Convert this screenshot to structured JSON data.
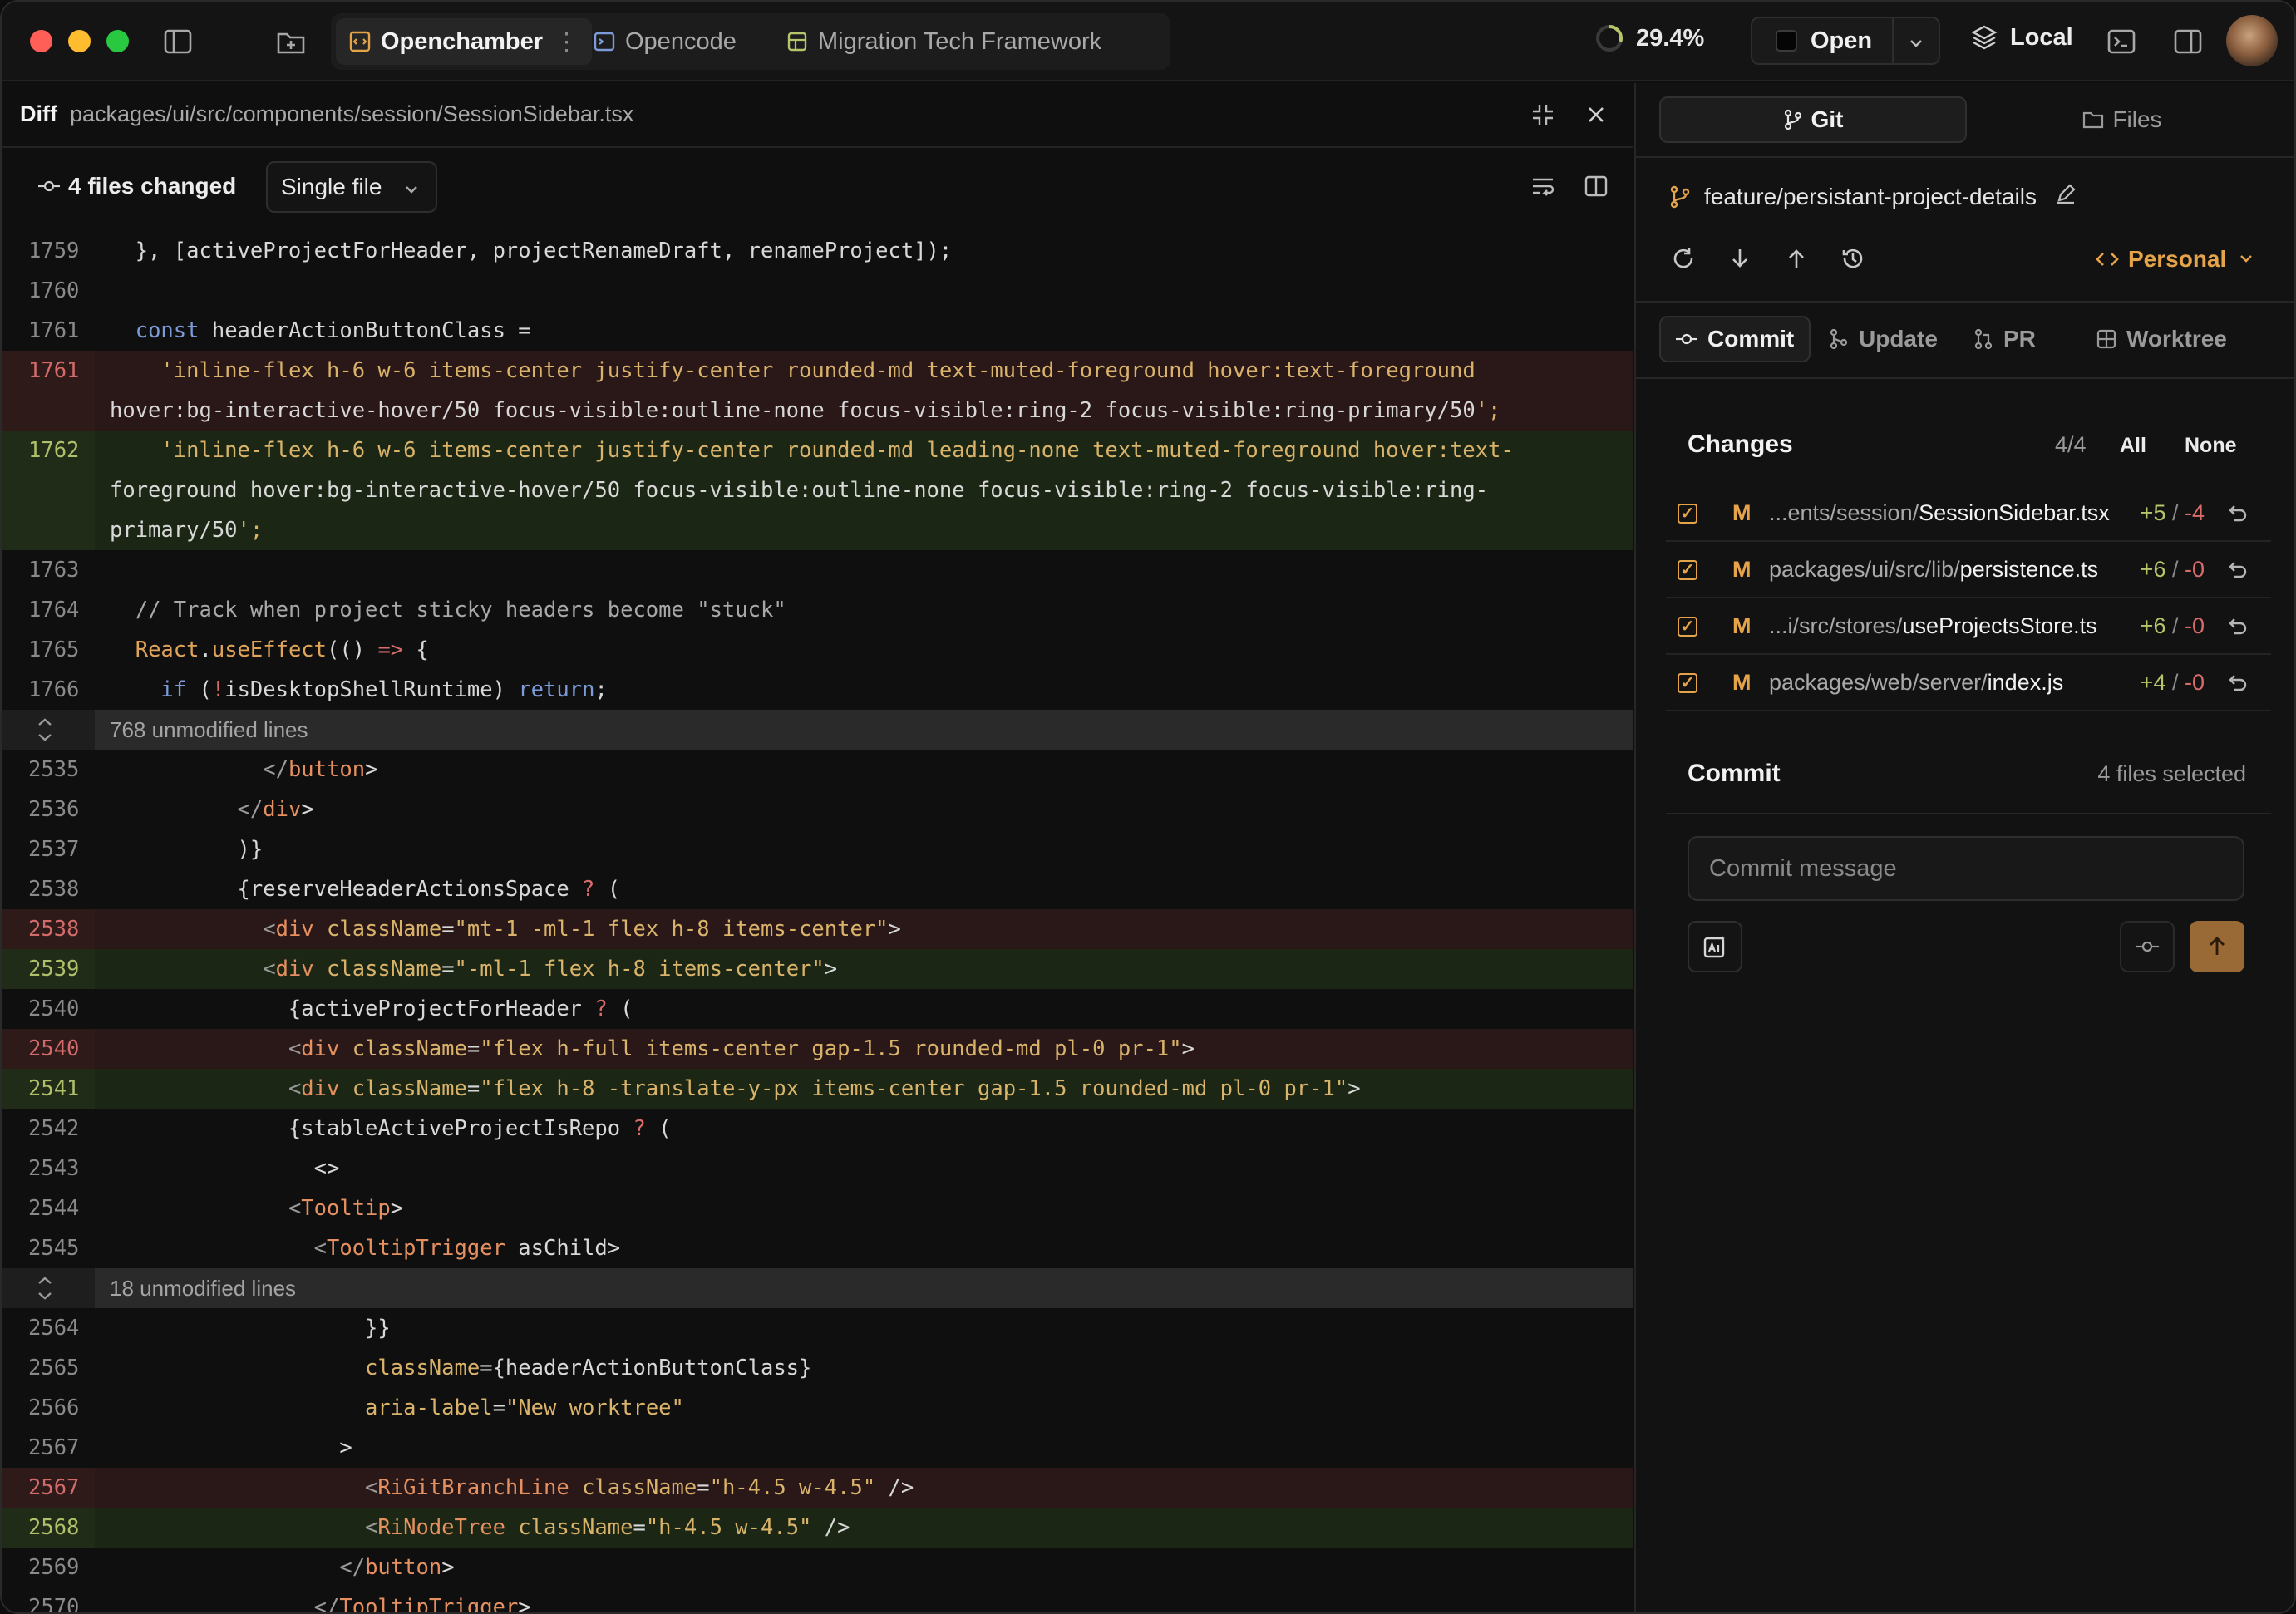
{
  "titlebar": {
    "tabs": [
      {
        "label": "Openchamber",
        "active": true
      },
      {
        "label": "Opencode",
        "active": false
      },
      {
        "label": "Migration Tech Framework",
        "active": false
      }
    ],
    "progress": "29.4%",
    "open_label": "Open",
    "location": "Local"
  },
  "diff": {
    "label": "Diff",
    "path": "packages/ui/src/components/session/SessionSidebar.tsx",
    "files_changed": "4 files changed",
    "view_mode": "Single file"
  },
  "code_lines": [
    {
      "n": "1759",
      "t": "ctx",
      "c": "  }, [activeProjectForHeader, projectRenameDraft, renameProject]);"
    },
    {
      "n": "1760",
      "t": "ctx",
      "c": ""
    },
    {
      "n": "1761",
      "t": "ctx",
      "c": "  const headerActionButtonClass ="
    },
    {
      "n": "1761",
      "t": "del",
      "c": "    'inline-flex h-6 w-6 items-center justify-center rounded-md text-muted-foreground hover:text-foreground"
    },
    {
      "n": "",
      "t": "del",
      "c": "hover:bg-interactive-hover/50 focus-visible:outline-none focus-visible:ring-2 focus-visible:ring-primary/50';"
    },
    {
      "n": "1762",
      "t": "add",
      "c": "    'inline-flex h-6 w-6 items-center justify-center rounded-md leading-none text-muted-foreground hover:text-"
    },
    {
      "n": "",
      "t": "add",
      "c": "foreground hover:bg-interactive-hover/50 focus-visible:outline-none focus-visible:ring-2 focus-visible:ring-"
    },
    {
      "n": "",
      "t": "add",
      "c": "primary/50';"
    },
    {
      "n": "1763",
      "t": "ctx",
      "c": ""
    },
    {
      "n": "1764",
      "t": "ctx",
      "c": "  // Track when project sticky headers become \"stuck\""
    },
    {
      "n": "1765",
      "t": "ctx",
      "c": "  React.useEffect(() => {"
    },
    {
      "n": "1766",
      "t": "ctx",
      "c": "    if (!isDesktopShellRuntime) return;"
    },
    {
      "n": "",
      "t": "fold",
      "c": "768 unmodified lines"
    },
    {
      "n": "2535",
      "t": "ctx",
      "c": "            </button>"
    },
    {
      "n": "2536",
      "t": "ctx",
      "c": "          </div>"
    },
    {
      "n": "2537",
      "t": "ctx",
      "c": "          )}"
    },
    {
      "n": "2538",
      "t": "ctx",
      "c": "          {reserveHeaderActionsSpace ? ("
    },
    {
      "n": "2538",
      "t": "del",
      "c": "            <div className=\"mt-1 -ml-1 flex h-8 items-center\">"
    },
    {
      "n": "2539",
      "t": "add",
      "c": "            <div className=\"-ml-1 flex h-8 items-center\">"
    },
    {
      "n": "2540",
      "t": "ctx",
      "c": "              {activeProjectForHeader ? ("
    },
    {
      "n": "2540",
      "t": "del",
      "c": "              <div className=\"flex h-full items-center gap-1.5 rounded-md pl-0 pr-1\">"
    },
    {
      "n": "2541",
      "t": "add",
      "c": "              <div className=\"flex h-8 -translate-y-px items-center gap-1.5 rounded-md pl-0 pr-1\">"
    },
    {
      "n": "2542",
      "t": "ctx",
      "c": "              {stableActiveProjectIsRepo ? ("
    },
    {
      "n": "2543",
      "t": "ctx",
      "c": "                <>"
    },
    {
      "n": "2544",
      "t": "ctx",
      "c": "              <Tooltip>"
    },
    {
      "n": "2545",
      "t": "ctx",
      "c": "                <TooltipTrigger asChild>"
    },
    {
      "n": "",
      "t": "fold",
      "c": "18 unmodified lines"
    },
    {
      "n": "2564",
      "t": "ctx",
      "c": "                    }}"
    },
    {
      "n": "2565",
      "t": "ctx",
      "c": "                    className={headerActionButtonClass}"
    },
    {
      "n": "2566",
      "t": "ctx",
      "c": "                    aria-label=\"New worktree\""
    },
    {
      "n": "2567",
      "t": "ctx",
      "c": "                  >"
    },
    {
      "n": "2567",
      "t": "del",
      "c": "                    <RiGitBranchLine className=\"h-4.5 w-4.5\" />"
    },
    {
      "n": "2568",
      "t": "add",
      "c": "                    <RiNodeTree className=\"h-4.5 w-4.5\" />"
    },
    {
      "n": "2569",
      "t": "ctx",
      "c": "                  </button>"
    },
    {
      "n": "2570",
      "t": "ctx",
      "c": "                </TooltipTrigger>"
    }
  ],
  "git_panel": {
    "tab_git": "Git",
    "tab_files": "Files",
    "branch": "feature/persistant-project-details",
    "identity": "Personal",
    "subtabs": [
      "Commit",
      "Update",
      "PR",
      "Worktree"
    ],
    "changes_title": "Changes",
    "changes_count": "4/4",
    "select_all": "All",
    "select_none": "None",
    "files": [
      {
        "status": "M",
        "dir": "...ents/session/",
        "name": "SessionSidebar.tsx",
        "added": "+5",
        "removed": "-4"
      },
      {
        "status": "M",
        "dir": "packages/ui/src/lib/",
        "name": "persistence.ts",
        "added": "+6",
        "removed": "-0"
      },
      {
        "status": "M",
        "dir": "...i/src/stores/",
        "name": "useProjectsStore.ts",
        "added": "+6",
        "removed": "-0"
      },
      {
        "status": "M",
        "dir": "packages/web/server/",
        "name": "index.js",
        "added": "+4",
        "removed": "-0"
      }
    ],
    "commit_title": "Commit",
    "commit_selected": "4 files selected",
    "commit_placeholder": "Commit message"
  },
  "colors": {
    "accent": "#e6a44a",
    "added": "#b7c46a",
    "removed": "#d96b6b",
    "push_button": "#9a6a36"
  }
}
